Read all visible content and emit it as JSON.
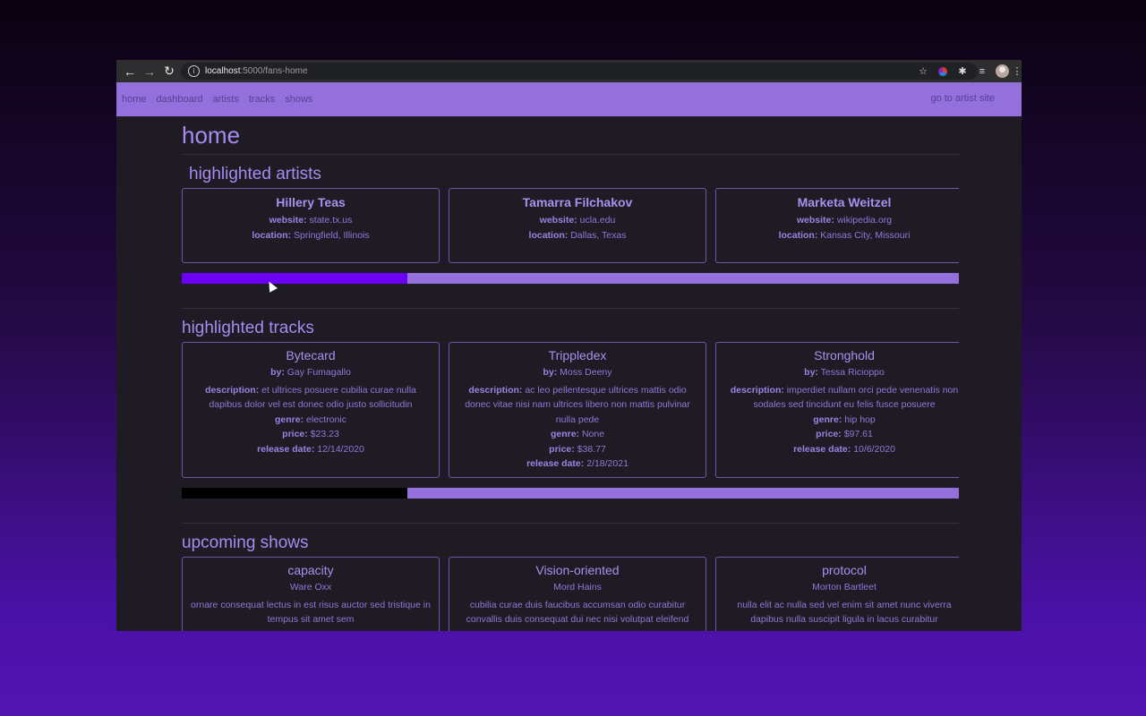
{
  "browser": {
    "url_host": "localhost",
    "url_path": ":5000/fans-home"
  },
  "sitenav": {
    "links": [
      "home",
      "dashboard",
      "artists",
      "tracks",
      "shows"
    ],
    "right_link": "go to artist site"
  },
  "page": {
    "title": "home"
  },
  "highlighted_artists": {
    "title": "highlighted artists",
    "labels": {
      "website": "website:",
      "location": "location:"
    },
    "items": [
      {
        "name": "Hillery Teas",
        "website": "state.tx.us",
        "location": "Springfield, Illinois"
      },
      {
        "name": "Tamarra Filchakov",
        "website": "ucla.edu",
        "location": "Dallas, Texas"
      },
      {
        "name": "Marketa Weitzel",
        "website": "wikipedia.org",
        "location": "Kansas City, Missouri"
      }
    ],
    "scroll_progress": 0.29,
    "scroll_color": "#6a00f4"
  },
  "highlighted_tracks": {
    "title": "highlighted tracks",
    "labels": {
      "by": "by:",
      "description": "description:",
      "genre": "genre:",
      "price": "price:",
      "release_date": "release date:"
    },
    "items": [
      {
        "title": "Bytecard",
        "by": "Gay Fumagallo",
        "description": "et ultrices posuere cubilia curae nulla dapibus dolor vel est donec odio justo sollicitudin",
        "genre": "electronic",
        "price": "$23.23",
        "release_date": "12/14/2020"
      },
      {
        "title": "Trippledex",
        "by": "Moss Deeny",
        "description": "ac leo pellentesque ultrices mattis odio donec vitae nisi nam ultrices libero non mattis pulvinar nulla pede",
        "genre": "None",
        "price": "$38.77",
        "release_date": "2/18/2021"
      },
      {
        "title": "Stronghold",
        "by": "Tessa Ricioppo",
        "description": "imperdiet nullam orci pede venenatis non sodales sed tincidunt eu felis fusce posuere",
        "genre": "hip hop",
        "price": "$97.61",
        "release_date": "10/6/2020"
      }
    ],
    "scroll_progress": 0.29,
    "scroll_color": "#000000"
  },
  "upcoming_shows": {
    "title": "upcoming shows",
    "items": [
      {
        "title": "capacity",
        "artist": "Ware Oxx",
        "description": "ornare consequat lectus in est risus auctor sed tristique in tempus sit amet sem"
      },
      {
        "title": "Vision-oriented",
        "artist": "Mord Hains",
        "description": "cubilia curae duis faucibus accumsan odio curabitur convallis duis consequat dui nec nisi volutpat eleifend"
      },
      {
        "title": "protocol",
        "artist": "Morton Bartleet",
        "description": "nulla elit ac nulla sed vel enim sit amet nunc viverra dapibus nulla suscipit ligula in lacus curabitur"
      }
    ]
  },
  "colors": {
    "accent": "#9370db",
    "page_bg": "#1f1b24",
    "text": "#a78bf0"
  }
}
